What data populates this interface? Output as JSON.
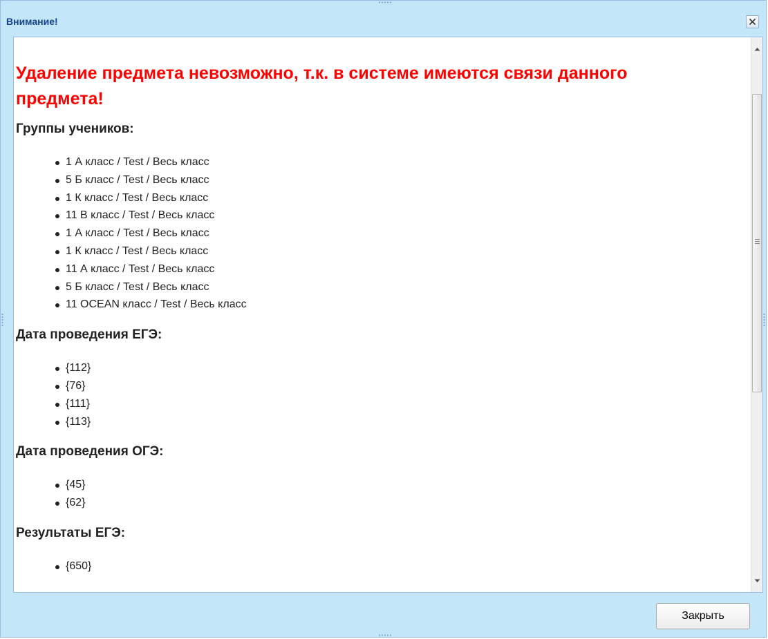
{
  "window": {
    "title": "Внимание!"
  },
  "message": {
    "heading": "Удаление предмета невозможно, т.к. в системе имеются связи данного предмета!",
    "sections": [
      {
        "title": "Группы учеников:",
        "items": [
          "1 А класс / Test / Весь класс",
          "5 Б класс / Test / Весь класс",
          "1 К класс / Test / Весь класс",
          "11 В класс / Test / Весь класс",
          "1 А класс / Test / Весь класс",
          "1 К класс / Test / Весь класс",
          "11 А класс / Test / Весь класс",
          "5 Б класс / Test / Весь класс",
          "11 OCEAN класс / Test / Весь класс"
        ]
      },
      {
        "title": "Дата проведения ЕГЭ:",
        "items": [
          "{112}",
          "{76}",
          "{111}",
          "{113}"
        ]
      },
      {
        "title": "Дата проведения ОГЭ:",
        "items": [
          "{45}",
          "{62}"
        ]
      },
      {
        "title": "Результаты ЕГЭ:",
        "items": [
          "{650}"
        ]
      }
    ]
  },
  "footer": {
    "close_label": "Закрыть"
  },
  "colors": {
    "heading": "#ff0000",
    "window_bg": "#c3e6f8",
    "title_text": "#15428b"
  },
  "icons": {
    "close": "close-icon",
    "scroll_up": "scroll-up-arrow-icon",
    "scroll_down": "scroll-down-arrow-icon"
  }
}
